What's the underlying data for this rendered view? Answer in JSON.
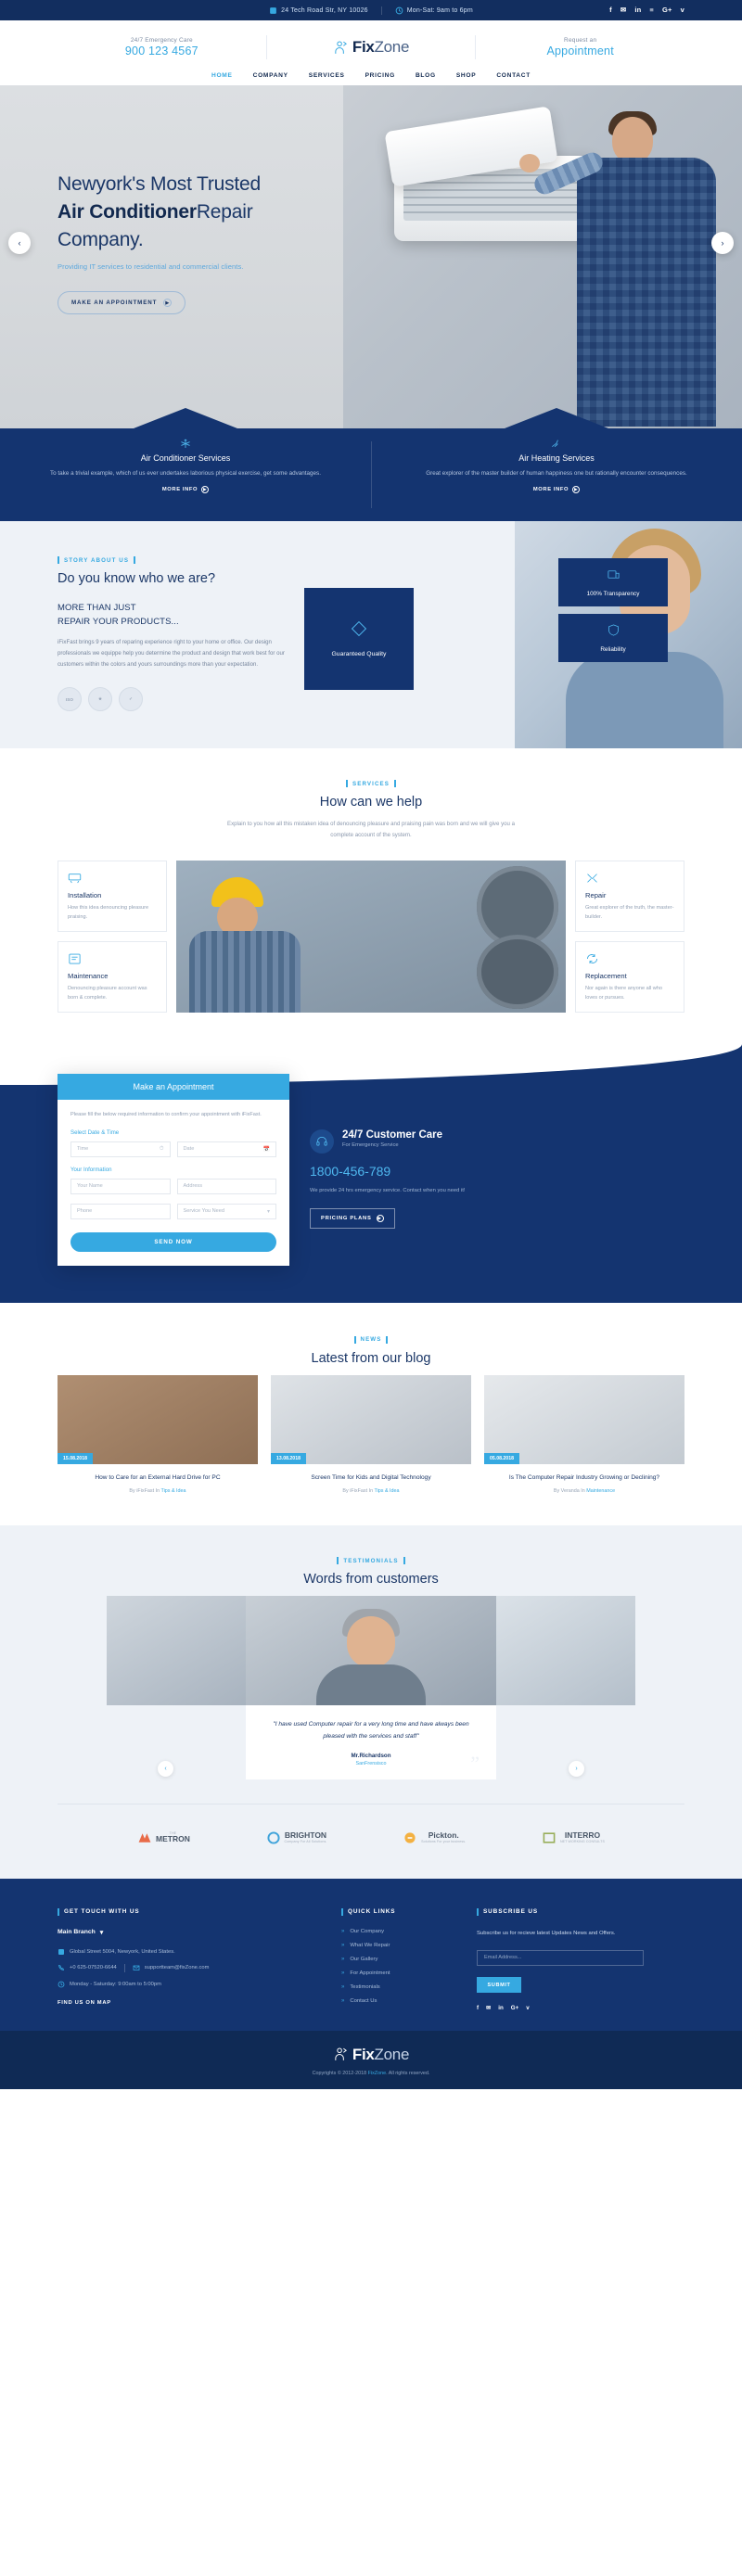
{
  "topbar": {
    "address": "24 Tech Road Str, NY 10026",
    "hours": "Mon-Sat: 9am to 6pm",
    "social": [
      "f",
      "✉",
      "in",
      "≡",
      "G+",
      "v"
    ]
  },
  "header": {
    "emergency_label": "24/7 Emergency Care",
    "emergency_phone": "900 123 4567",
    "logo_bold": "Fix",
    "logo_light": "Zone",
    "request_label": "Request an",
    "request_link": "Appointment",
    "nav": [
      {
        "label": "HOME",
        "active": true
      },
      {
        "label": "COMPANY",
        "active": false
      },
      {
        "label": "SERVICES",
        "active": false
      },
      {
        "label": "PRICING",
        "active": false
      },
      {
        "label": "BLOG",
        "active": false
      },
      {
        "label": "SHOP",
        "active": false
      },
      {
        "label": "CONTACT",
        "active": false
      }
    ]
  },
  "hero": {
    "line1": "Newyork's Most Trusted",
    "line2_bold": "Air Conditioner",
    "line2_rest": "Repair",
    "line3": "Company.",
    "subtitle": "Providing IT services to residential and commercial clients.",
    "button": "MAKE AN APPOINTMENT",
    "prev": "‹",
    "next": "›"
  },
  "service_strip": [
    {
      "title": "Air Conditioner Services",
      "desc": "To take a trivial example, which of us ever undertakes laborious physical exercise, get some advantages.",
      "more": "MORE INFO"
    },
    {
      "title": "Air Heating Services",
      "desc": "Great explorer of the master builder of human happiness one but rationally encounter consequences.",
      "more": "MORE INFO"
    }
  ],
  "about": {
    "eyebrow": "STORY ABOUT US",
    "heading": "Do you know who we are?",
    "subheading_l1": "MORE THAN JUST",
    "subheading_l2": "REPAIR YOUR PRODUCTS...",
    "paragraph": "iFixFast brings 9 years of reparing experience right to your home or office. Our design professionals we equippe help you determine the product and design that work best for our customers within the colors and yours surroundings more than your expectation.",
    "badges": [
      "ISO CERTIFIED",
      "BEST AWARD",
      "VERIFIED"
    ],
    "quality_card": "Guaranteed Quality",
    "features": [
      {
        "label": "100% Transparency"
      },
      {
        "label": "Reliability"
      }
    ]
  },
  "help": {
    "eyebrow": "SERVICES",
    "heading": "How can we help",
    "paragraph": "Explain to you how all this mistaken idea of denouncing pleasure and praising pain was born and we will give you a complete account of the system.",
    "left_cards": [
      {
        "title": "Installation",
        "desc": "How this idea denouncing pleasure praising."
      },
      {
        "title": "Maintenance",
        "desc": "Denouncing pleasure account was born & complete."
      }
    ],
    "right_cards": [
      {
        "title": "Repair",
        "desc": "Great explorer of the truth, the master-builder."
      },
      {
        "title": "Replacement",
        "desc": "Nor again is there anyone all who loves or pursues."
      }
    ]
  },
  "appointment": {
    "form_title": "Make an Appointment",
    "note": "Please fill the below required information to confirm your appointment with iFixFast.",
    "section_label_1": "Select Date & Time",
    "field_time": "Time",
    "field_date": "Date",
    "section_label_2": "Your Information",
    "field_name": "Your Name",
    "field_address": "Address",
    "field_phone": "Phone",
    "field_service": "Service You Need",
    "send_button": "SEND NOW",
    "care_title": "24/7 Customer Care",
    "care_subtitle": "For Emergency Service",
    "care_phone": "1800-456-789",
    "care_paragraph": "We provide 24 hrs emergency service. Contact when you need it!",
    "care_button": "PRICING PLANS"
  },
  "blog": {
    "eyebrow": "NEWS",
    "heading": "Latest from our blog",
    "posts": [
      {
        "date": "15.08.2018",
        "title": "How to Care for an External Hard Drive for PC",
        "meta_pre": "By iFixFast In ",
        "meta_cat": "Tips & Idea"
      },
      {
        "date": "13.08.2018",
        "title": "Screen Time for Kids and Digital Technology",
        "meta_pre": "By iFixFast In ",
        "meta_cat": "Tips & Idea"
      },
      {
        "date": "05.08.2018",
        "title": "Is The Computer Repair Industry Growing or Declining?",
        "meta_pre": "By Veranda In ",
        "meta_cat": "Maintenance"
      }
    ]
  },
  "testimonials": {
    "eyebrow": "TESTIMONIALS",
    "heading": "Words from customers",
    "quote": "\"I have used Computer repair for a very long time and have always been pleased with the services and staff\"",
    "name": "Mr.Richardson",
    "role": "SanFrensisco",
    "prev": "‹",
    "next": "›",
    "brands": [
      {
        "name": "METRON",
        "top": "THE",
        "sub": ""
      },
      {
        "name": "BRIGHTON",
        "top": "",
        "sub": "Company For All Solutions."
      },
      {
        "name": "Pickton.",
        "top": "",
        "sub": "Solutions For your business."
      },
      {
        "name": "INTERRO",
        "top": "",
        "sub": "NET WORKING CONSULTS"
      }
    ]
  },
  "footer": {
    "col1_head": "GET TOUCH WITH US",
    "branch": "Main Branch",
    "address": "Global Street 5004, Newyork, United States.",
    "phone": "+0 625-07520-6644",
    "email": "supportteam@fixZone.com",
    "hours": "Monday - Saturday: 9:00am to 5:00pm",
    "map_link": "FIND US ON MAP",
    "col2_head": "QUICK LINKS",
    "links": [
      "Our Company",
      "What We Repair",
      "Our Gallery",
      "For Appointment",
      "Testimonials",
      "Contact Us"
    ],
    "col3_head": "SUBSCRIBE US",
    "subscribe_text": "Subscribe us for recieve latest Updates News and Offers.",
    "email_placeholder": "Email Address...",
    "subscribe_button": "SUBMIT",
    "social": [
      "f",
      "✉",
      "in",
      "G+",
      "v"
    ],
    "bottom_logo_bold": "Fix",
    "bottom_logo_light": "Zone",
    "copyright_pre": "Copyrights © 2012-2018 ",
    "copyright_brand": "FixZone",
    "copyright_post": ". All rights reserved."
  },
  "colors": {
    "navy": "#143470",
    "navy_dark": "#0f2a55",
    "accent": "#36a9e1",
    "light_bg": "#eef2f7"
  }
}
